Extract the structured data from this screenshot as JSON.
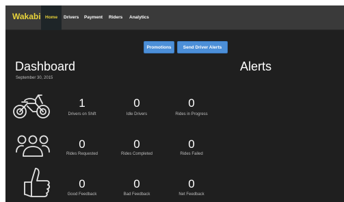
{
  "navbar": {
    "brand": "Wakabi",
    "items": [
      {
        "label": "Home",
        "active": true
      },
      {
        "label": "Drivers"
      },
      {
        "label": "Payment"
      },
      {
        "label": "Riders"
      },
      {
        "label": "Analytics"
      }
    ]
  },
  "toolbar": {
    "promotions_label": "Promotions",
    "send_alerts_label": "Send Driver Alerts"
  },
  "dashboard": {
    "title": "Dashboard",
    "date": "September 30, 2015",
    "rows": [
      {
        "icon": "motorcycle-icon",
        "stats": [
          {
            "value": "1",
            "label": "Drivers on Shift"
          },
          {
            "value": "0",
            "label": "Idle Drivers"
          },
          {
            "value": "0",
            "label": "Rides in Progress"
          }
        ]
      },
      {
        "icon": "people-icon",
        "stats": [
          {
            "value": "0",
            "label": "Rides Requested"
          },
          {
            "value": "0",
            "label": "Rides Completed"
          },
          {
            "value": "0",
            "label": "Rides Failed"
          }
        ]
      },
      {
        "icon": "thumbs-up-icon",
        "stats": [
          {
            "value": "0",
            "label": "Good Feedback"
          },
          {
            "value": "0",
            "label": "Bad Feedback"
          },
          {
            "value": "0",
            "label": "Net Feedback"
          }
        ]
      }
    ]
  },
  "alerts": {
    "title": "Alerts"
  },
  "colors": {
    "brand": "#e8d33a",
    "button": "#4c8fd8",
    "background": "#1f1f1f",
    "navbar": "#3a3a3a"
  }
}
